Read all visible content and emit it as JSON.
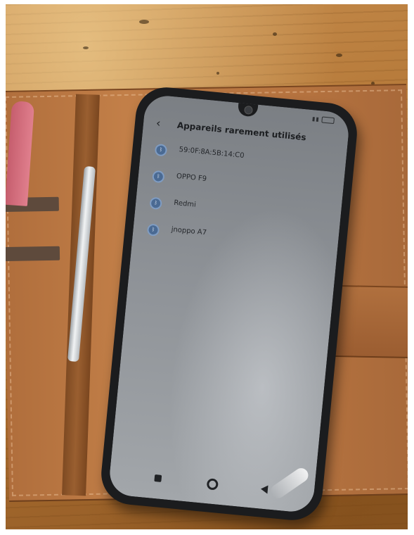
{
  "screen": {
    "title": "Appareils rarement utilisés",
    "back_icon": "back-chevron-icon",
    "devices": [
      {
        "name": "59:0F:8A:5B:14:C0",
        "icon": "bluetooth-icon"
      },
      {
        "name": "OPPO F9",
        "icon": "bluetooth-icon"
      },
      {
        "name": "Redmi",
        "icon": "bluetooth-icon"
      },
      {
        "name": "jnoppo A7",
        "icon": "bluetooth-icon"
      }
    ]
  },
  "colors": {
    "table": "#b67a3a",
    "wallet": "#b77440",
    "phone_frame": "#1b1c1e",
    "screen": "#8e9297",
    "accent_icon": "#4a6a93"
  }
}
